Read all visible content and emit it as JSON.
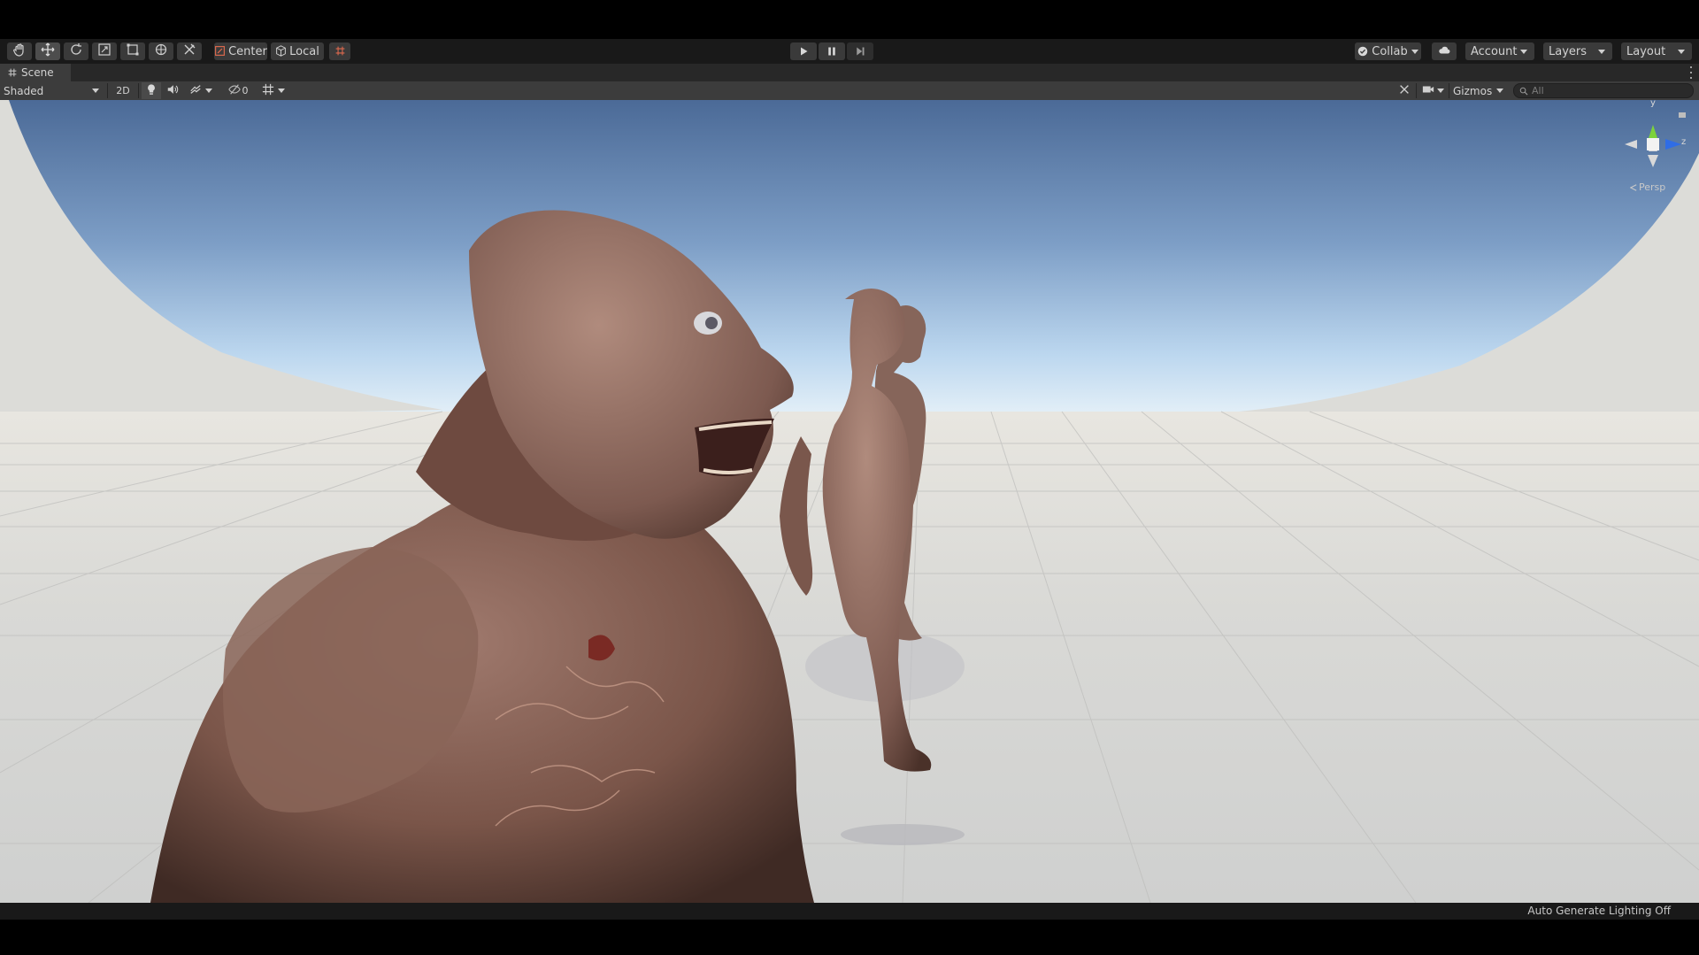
{
  "toolbar": {
    "tools": [
      {
        "name": "hand-tool-button",
        "icon": "hand-icon"
      },
      {
        "name": "move-tool-button",
        "icon": "move-icon",
        "selected": true
      },
      {
        "name": "rotate-tool-button",
        "icon": "rotate-icon"
      },
      {
        "name": "scale-tool-button",
        "icon": "scale-icon"
      },
      {
        "name": "rect-tool-button",
        "icon": "rect-icon"
      },
      {
        "name": "transform-tool-button",
        "icon": "transform-icon"
      },
      {
        "name": "custom-tool-button",
        "icon": "custom-tool-icon"
      }
    ],
    "pivot_label": "Center",
    "space_label": "Local",
    "collab_label": "Collab",
    "account_label": "Account",
    "layers_label": "Layers",
    "layout_label": "Layout"
  },
  "scene_tab": {
    "label": "Scene"
  },
  "scene_toolbar": {
    "draw_mode": "Shaded",
    "mode_2d_label": "2D",
    "hidden_count": "0",
    "gizmos_label": "Gizmos",
    "search_placeholder": "All"
  },
  "orientation_gizmo": {
    "y_label": "y",
    "z_label": "z",
    "projection_label": "Persp"
  },
  "status_bar": {
    "lighting_text": "Auto Generate Lighting Off"
  },
  "colors": {
    "toolbar_bg": "#191919",
    "button_bg": "#3a3a3a",
    "scene_toolbar_bg": "#3c3c3c",
    "sky_top": "#4f6e9a",
    "horizon": "#cfe3f4",
    "ground": "#d9d9d7",
    "axis_y": "#7cd23c",
    "axis_z": "#2f6de6",
    "axis_x": "#d9d9d9"
  }
}
